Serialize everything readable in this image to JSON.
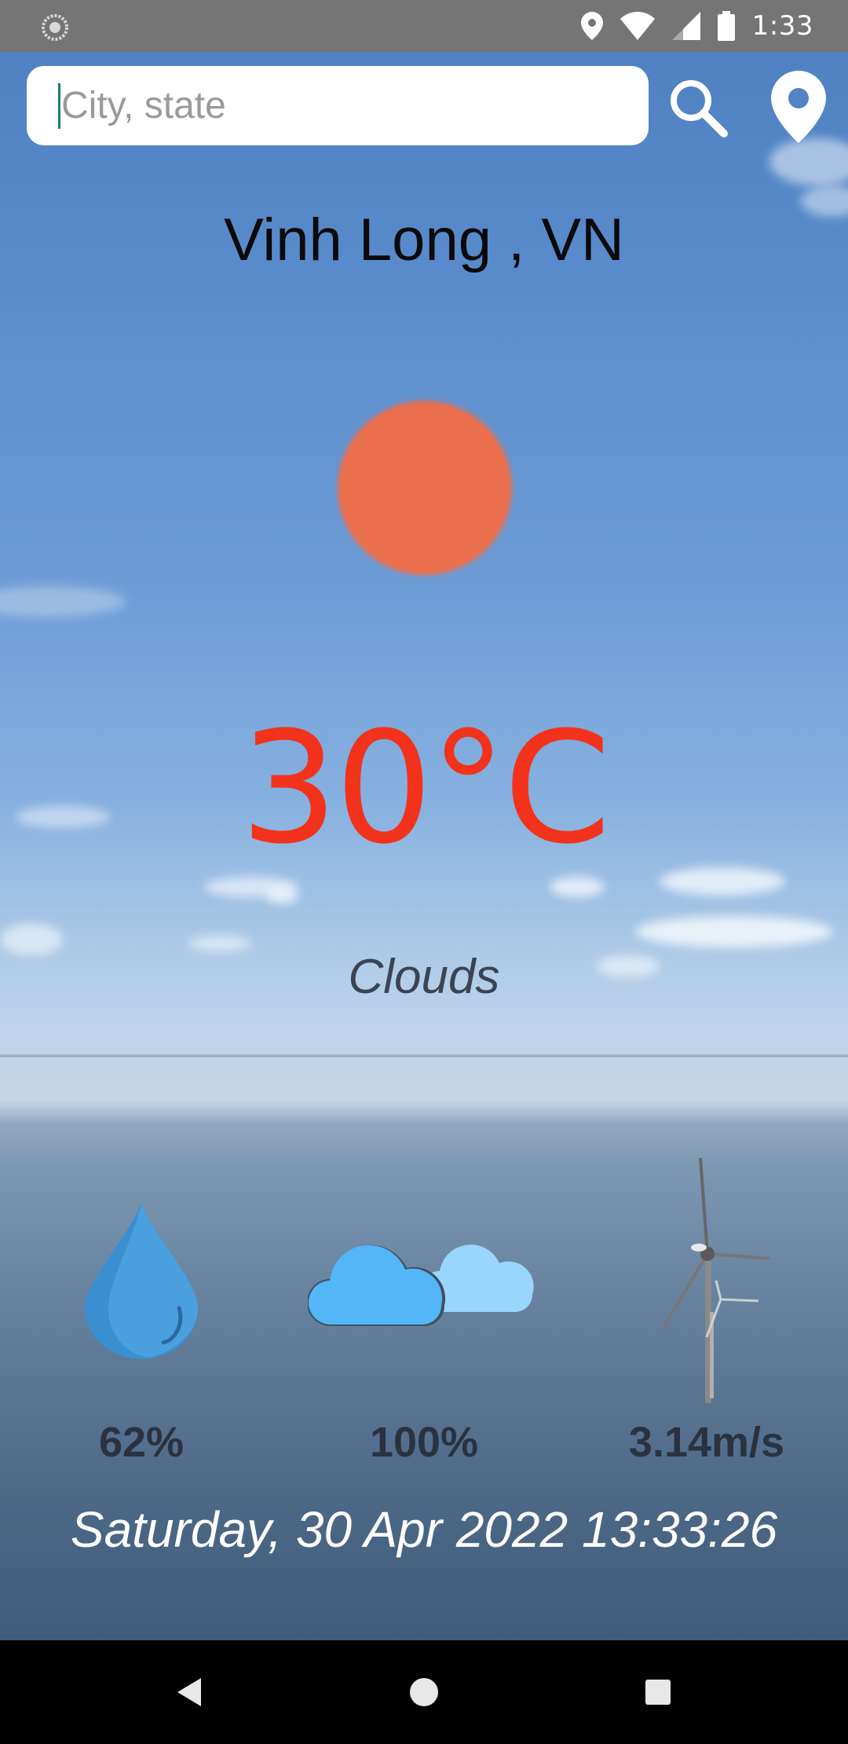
{
  "status_bar": {
    "time": "1:33",
    "icons": [
      "loading-icon",
      "location-pin-icon",
      "wifi-icon",
      "signal-icon",
      "battery-icon"
    ]
  },
  "search": {
    "placeholder": "City, state",
    "value": ""
  },
  "weather": {
    "city": "Vinh Long , VN",
    "temperature": "30°C",
    "condition": "Clouds",
    "humidity": "62%",
    "cloudiness": "100%",
    "wind_speed": "3.14m/s",
    "datetime": "Saturday, 30 Apr 2022 13:33:26"
  },
  "colors": {
    "temperature": "#f2321b",
    "sun": "#ec6f4d",
    "status_bar": "#757575"
  },
  "navigation": {
    "icons": [
      "back-icon",
      "home-icon",
      "recents-icon"
    ]
  }
}
